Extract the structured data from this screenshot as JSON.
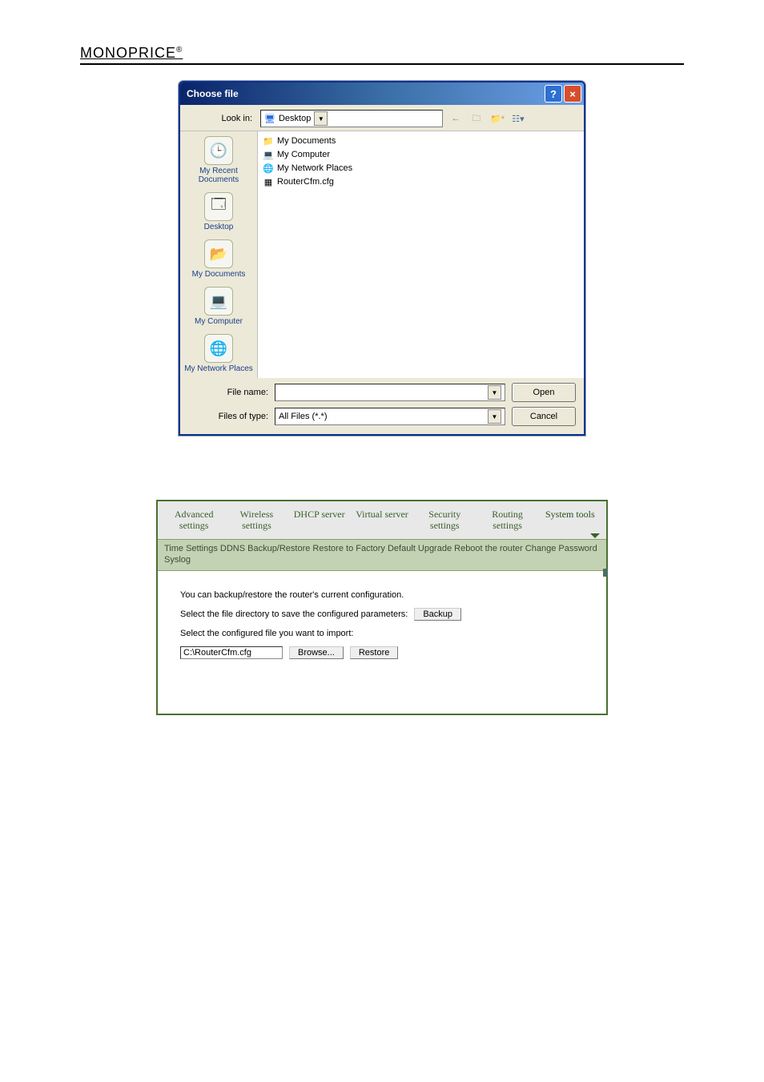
{
  "brand_text": "MONOPRICE",
  "brand_mark": "®",
  "dialog": {
    "title": "Choose file",
    "look_in_label": "Look in:",
    "look_in_value": "Desktop",
    "tb_back_icon": "←",
    "places": [
      {
        "label": "My Recent Documents",
        "glyph": "🕒"
      },
      {
        "label": "Desktop",
        "glyph": "🗔"
      },
      {
        "label": "My Documents",
        "glyph": "📂"
      },
      {
        "label": "My Computer",
        "glyph": "💻"
      },
      {
        "label": "My Network Places",
        "glyph": "🌐"
      }
    ],
    "files": [
      {
        "name": "My Documents",
        "glyph": "📁",
        "icon_name": "folder-icon"
      },
      {
        "name": "My Computer",
        "glyph": "💻",
        "icon_name": "computer-icon"
      },
      {
        "name": "My Network Places",
        "glyph": "🌐",
        "icon_name": "network-places-icon"
      },
      {
        "name": "RouterCfm.cfg",
        "glyph": "▦",
        "icon_name": "config-file-icon"
      }
    ],
    "file_name_label": "File name:",
    "file_name_value": "",
    "files_of_type_label": "Files of type:",
    "files_of_type_value": "All Files (*.*)",
    "open_button": "Open",
    "cancel_button": "Cancel",
    "help_glyph": "?",
    "close_glyph": "×"
  },
  "router": {
    "tabs": [
      "Advanced settings",
      "Wireless settings",
      "DHCP server",
      "Virtual server",
      "Security settings",
      "Routing settings",
      "System tools"
    ],
    "active_tab_index": 6,
    "subnav_text": "Time Settings  DDNS  Backup/Restore  Restore to Factory Default  Upgrade  Reboot the router  Change Password  Syslog",
    "desc": "You can backup/restore the router's current configuration.",
    "backup_label": "Select the file directory to save the configured parameters:",
    "backup_button": "Backup",
    "import_label": "Select the configured file you want to import:",
    "import_path": "C:\\RouterCfm.cfg",
    "browse_button": "Browse...",
    "restore_button": "Restore"
  }
}
